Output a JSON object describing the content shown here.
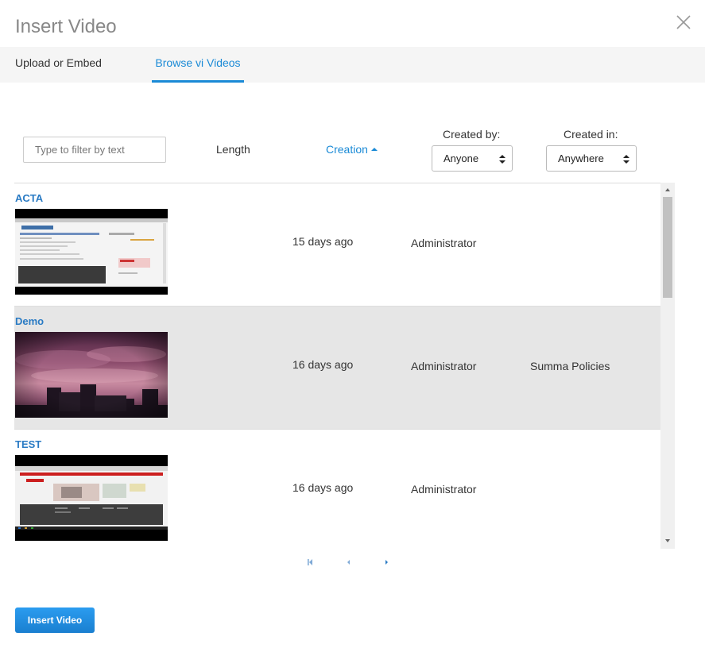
{
  "dialog": {
    "title": "Insert Video"
  },
  "tabs": [
    {
      "label": "Upload or Embed",
      "active": false
    },
    {
      "label": "Browse vi Videos",
      "active": true
    }
  ],
  "filters": {
    "text_placeholder": "Type to filter by text",
    "length_label": "Length",
    "creation_label": "Creation",
    "created_by_label": "Created by:",
    "created_by_value": "Anyone",
    "created_in_label": "Created in:",
    "created_in_value": "Anywhere"
  },
  "videos": [
    {
      "title": "ACTA",
      "age": "15 days ago",
      "creator": "Administrator",
      "location": "",
      "thumbnail": "screenshot-thumbnail"
    },
    {
      "title": "Demo",
      "age": "16 days ago",
      "creator": "Administrator",
      "location": "Summa Policies",
      "thumbnail": "sunset-clouds-thumbnail"
    },
    {
      "title": "TEST",
      "age": "16 days ago",
      "creator": "Administrator",
      "location": "",
      "thumbnail": "webpage-thumbnail"
    }
  ],
  "actions": {
    "insert_label": "Insert Video"
  },
  "colors": {
    "accent": "#1a8ad6",
    "title_link": "#2a7bc4",
    "selected_row": "#e6e6e6"
  }
}
